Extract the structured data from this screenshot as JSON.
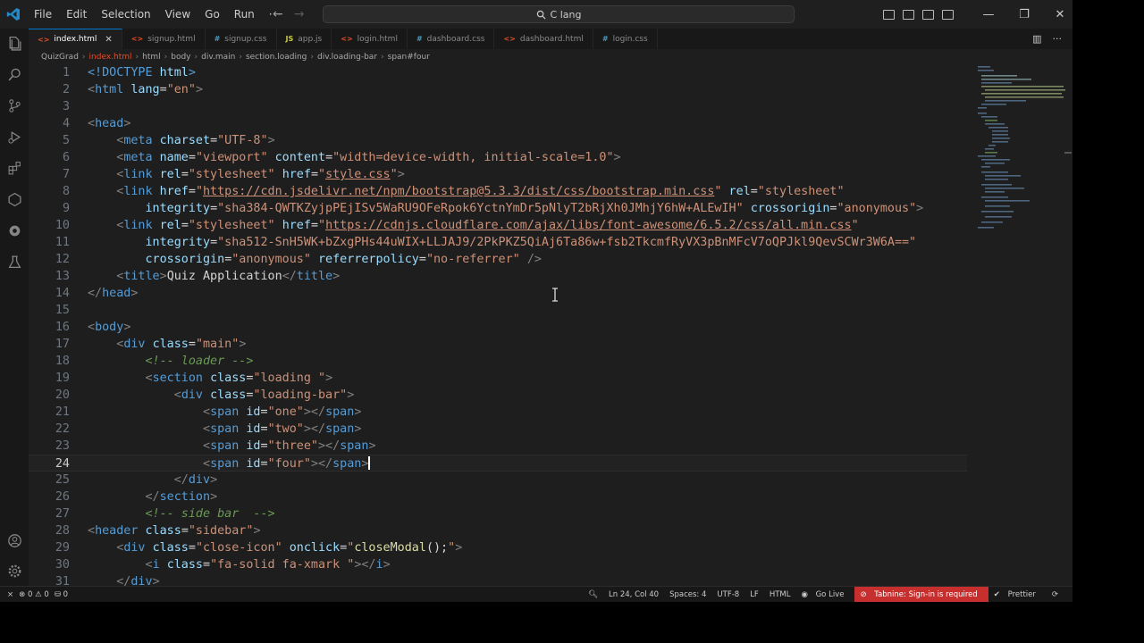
{
  "menu": [
    "File",
    "Edit",
    "Selection",
    "View",
    "Go",
    "Run",
    "···"
  ],
  "command_center": "C lang",
  "tabs": [
    {
      "label": "index.html",
      "icon": "<>",
      "color": "#e44d26",
      "active": true
    },
    {
      "label": "signup.html",
      "icon": "<>",
      "color": "#e44d26"
    },
    {
      "label": "signup.css",
      "icon": "#",
      "color": "#519aba"
    },
    {
      "label": "app.js",
      "icon": "JS",
      "color": "#cbcb41"
    },
    {
      "label": "login.html",
      "icon": "<>",
      "color": "#e44d26"
    },
    {
      "label": "dashboard.css",
      "icon": "#",
      "color": "#519aba"
    },
    {
      "label": "dashboard.html",
      "icon": "<>",
      "color": "#e44d26"
    },
    {
      "label": "login.css",
      "icon": "#",
      "color": "#519aba"
    }
  ],
  "breadcrumb": [
    "QuizGrad",
    "index.html",
    "html",
    "body",
    "div.main",
    "section.loading",
    "div.loading-bar",
    "span#four"
  ],
  "code_lines": [
    [
      [
        "t",
        "<!DOCTYPE "
      ],
      [
        "a",
        "html"
      ],
      [
        "t",
        ">"
      ]
    ],
    [
      [
        "p",
        "<"
      ],
      [
        "t",
        "html "
      ],
      [
        "a",
        "lang"
      ],
      [
        "x",
        "="
      ],
      [
        "s",
        "\"en\""
      ],
      [
        "p",
        ">"
      ]
    ],
    [],
    [
      [
        "p",
        "<"
      ],
      [
        "t",
        "head"
      ],
      [
        "p",
        ">"
      ]
    ],
    [
      [
        "x",
        "    "
      ],
      [
        "p",
        "<"
      ],
      [
        "t",
        "meta "
      ],
      [
        "a",
        "charset"
      ],
      [
        "x",
        "="
      ],
      [
        "s",
        "\"UTF-8\""
      ],
      [
        "p",
        ">"
      ]
    ],
    [
      [
        "x",
        "    "
      ],
      [
        "p",
        "<"
      ],
      [
        "t",
        "meta "
      ],
      [
        "a",
        "name"
      ],
      [
        "x",
        "="
      ],
      [
        "s",
        "\"viewport\" "
      ],
      [
        "a",
        "content"
      ],
      [
        "x",
        "="
      ],
      [
        "s",
        "\"width=device-width, initial-scale=1.0\""
      ],
      [
        "p",
        ">"
      ]
    ],
    [
      [
        "x",
        "    "
      ],
      [
        "p",
        "<"
      ],
      [
        "t",
        "link "
      ],
      [
        "a",
        "rel"
      ],
      [
        "x",
        "="
      ],
      [
        "s",
        "\"stylesheet\" "
      ],
      [
        "a",
        "href"
      ],
      [
        "x",
        "="
      ],
      [
        "s",
        "\""
      ],
      [
        "u",
        "style.css"
      ],
      [
        "s",
        "\""
      ],
      [
        "p",
        ">"
      ]
    ],
    [
      [
        "x",
        "    "
      ],
      [
        "p",
        "<"
      ],
      [
        "t",
        "link "
      ],
      [
        "a",
        "href"
      ],
      [
        "x",
        "="
      ],
      [
        "s",
        "\""
      ],
      [
        "u",
        "https://cdn.jsdelivr.net/npm/bootstrap@5.3.3/dist/css/bootstrap.min.css"
      ],
      [
        "s",
        "\" "
      ],
      [
        "a",
        "rel"
      ],
      [
        "x",
        "="
      ],
      [
        "s",
        "\"stylesheet\""
      ]
    ],
    [
      [
        "x",
        "        "
      ],
      [
        "a",
        "integrity"
      ],
      [
        "x",
        "="
      ],
      [
        "s",
        "\"sha384-QWTKZyjpPEjISv5WaRU9OFeRpok6YctnYmDr5pNlyT2bRjXh0JMhjY6hW+ALEwIH\" "
      ],
      [
        "a",
        "crossorigin"
      ],
      [
        "x",
        "="
      ],
      [
        "s",
        "\"anonymous\""
      ],
      [
        "p",
        ">"
      ]
    ],
    [
      [
        "x",
        "    "
      ],
      [
        "p",
        "<"
      ],
      [
        "t",
        "link "
      ],
      [
        "a",
        "rel"
      ],
      [
        "x",
        "="
      ],
      [
        "s",
        "\"stylesheet\" "
      ],
      [
        "a",
        "href"
      ],
      [
        "x",
        "="
      ],
      [
        "s",
        "\""
      ],
      [
        "u",
        "https://cdnjs.cloudflare.com/ajax/libs/font-awesome/6.5.2/css/all.min.css"
      ],
      [
        "s",
        "\""
      ]
    ],
    [
      [
        "x",
        "        "
      ],
      [
        "a",
        "integrity"
      ],
      [
        "x",
        "="
      ],
      [
        "s",
        "\"sha512-SnH5WK+bZxgPHs44uWIX+LLJAJ9/2PkPKZ5QiAj6Ta86w+fsb2TkcmfRyVX3pBnMFcV7oQPJkl9QevSCWr3W6A==\""
      ]
    ],
    [
      [
        "x",
        "        "
      ],
      [
        "a",
        "crossorigin"
      ],
      [
        "x",
        "="
      ],
      [
        "s",
        "\"anonymous\" "
      ],
      [
        "a",
        "referrerpolicy"
      ],
      [
        "x",
        "="
      ],
      [
        "s",
        "\"no-referrer\" "
      ],
      [
        "p",
        "/>"
      ]
    ],
    [
      [
        "x",
        "    "
      ],
      [
        "p",
        "<"
      ],
      [
        "t",
        "title"
      ],
      [
        "p",
        ">"
      ],
      [
        "x",
        "Quiz Application"
      ],
      [
        "p",
        "</"
      ],
      [
        "t",
        "title"
      ],
      [
        "p",
        ">"
      ]
    ],
    [
      [
        "p",
        "</"
      ],
      [
        "t",
        "head"
      ],
      [
        "p",
        ">"
      ]
    ],
    [],
    [
      [
        "p",
        "<"
      ],
      [
        "t",
        "body"
      ],
      [
        "p",
        ">"
      ]
    ],
    [
      [
        "x",
        "    "
      ],
      [
        "p",
        "<"
      ],
      [
        "t",
        "div "
      ],
      [
        "a",
        "class"
      ],
      [
        "x",
        "="
      ],
      [
        "s",
        "\"main\""
      ],
      [
        "p",
        ">"
      ]
    ],
    [
      [
        "x",
        "        "
      ],
      [
        "c",
        "<!-- loader -->"
      ]
    ],
    [
      [
        "x",
        "        "
      ],
      [
        "p",
        "<"
      ],
      [
        "t",
        "section "
      ],
      [
        "a",
        "class"
      ],
      [
        "x",
        "="
      ],
      [
        "s",
        "\"loading \""
      ],
      [
        "p",
        ">"
      ]
    ],
    [
      [
        "x",
        "            "
      ],
      [
        "p",
        "<"
      ],
      [
        "t",
        "div "
      ],
      [
        "a",
        "class"
      ],
      [
        "x",
        "="
      ],
      [
        "s",
        "\"loading-bar\""
      ],
      [
        "p",
        ">"
      ]
    ],
    [
      [
        "x",
        "                "
      ],
      [
        "p",
        "<"
      ],
      [
        "t",
        "span "
      ],
      [
        "a",
        "id"
      ],
      [
        "x",
        "="
      ],
      [
        "s",
        "\"one\""
      ],
      [
        "p",
        "></"
      ],
      [
        "t",
        "span"
      ],
      [
        "p",
        ">"
      ]
    ],
    [
      [
        "x",
        "                "
      ],
      [
        "p",
        "<"
      ],
      [
        "t",
        "span "
      ],
      [
        "a",
        "id"
      ],
      [
        "x",
        "="
      ],
      [
        "s",
        "\"two\""
      ],
      [
        "p",
        "></"
      ],
      [
        "t",
        "span"
      ],
      [
        "p",
        ">"
      ]
    ],
    [
      [
        "x",
        "                "
      ],
      [
        "p",
        "<"
      ],
      [
        "t",
        "span "
      ],
      [
        "a",
        "id"
      ],
      [
        "x",
        "="
      ],
      [
        "s",
        "\"three\""
      ],
      [
        "p",
        "></"
      ],
      [
        "t",
        "span"
      ],
      [
        "p",
        ">"
      ]
    ],
    [
      [
        "x",
        "                "
      ],
      [
        "p",
        "<"
      ],
      [
        "t",
        "span "
      ],
      [
        "a",
        "id"
      ],
      [
        "x",
        "="
      ],
      [
        "s",
        "\"four\""
      ],
      [
        "p",
        "></"
      ],
      [
        "t",
        "span"
      ],
      [
        "p",
        ">"
      ]
    ],
    [
      [
        "x",
        "            "
      ],
      [
        "p",
        "</"
      ],
      [
        "t",
        "div"
      ],
      [
        "p",
        ">"
      ]
    ],
    [
      [
        "x",
        "        "
      ],
      [
        "p",
        "</"
      ],
      [
        "t",
        "section"
      ],
      [
        "p",
        ">"
      ]
    ],
    [
      [
        "x",
        "        "
      ],
      [
        "c",
        "<!-- side bar  -->"
      ]
    ],
    [
      [
        "p",
        "<"
      ],
      [
        "t",
        "header "
      ],
      [
        "a",
        "class"
      ],
      [
        "x",
        "="
      ],
      [
        "s",
        "\"sidebar\""
      ],
      [
        "p",
        ">"
      ]
    ],
    [
      [
        "x",
        "    "
      ],
      [
        "p",
        "<"
      ],
      [
        "t",
        "div "
      ],
      [
        "a",
        "class"
      ],
      [
        "x",
        "="
      ],
      [
        "s",
        "\"close-icon\" "
      ],
      [
        "a",
        "onclick"
      ],
      [
        "x",
        "="
      ],
      [
        "s",
        "\""
      ],
      [
        "f",
        "closeModal"
      ],
      [
        "x",
        "();"
      ],
      [
        "s",
        "\""
      ],
      [
        "p",
        ">"
      ]
    ],
    [
      [
        "x",
        "        "
      ],
      [
        "p",
        "<"
      ],
      [
        "t",
        "i "
      ],
      [
        "a",
        "class"
      ],
      [
        "x",
        "="
      ],
      [
        "s",
        "\"fa-solid fa-xmark \""
      ],
      [
        "p",
        "></"
      ],
      [
        "t",
        "i"
      ],
      [
        "p",
        ">"
      ]
    ],
    [
      [
        "x",
        "    "
      ],
      [
        "p",
        "</"
      ],
      [
        "t",
        "div"
      ],
      [
        "p",
        ">"
      ]
    ]
  ],
  "current_line": 24,
  "status": {
    "errors": "0",
    "warnings": "0",
    "ports": "0",
    "position": "Ln 24, Col 40",
    "spaces": "Spaces: 4",
    "encoding": "UTF-8",
    "eol": "LF",
    "language": "HTML",
    "golive": "Go Live",
    "tabnine": "Tabnine: Sign-in is required",
    "prettier": "Prettier"
  },
  "colors": {
    "accent": "#0078d4",
    "tabnine_bg": "#c72e2e",
    "editor_bg": "#1e1e1e"
  }
}
